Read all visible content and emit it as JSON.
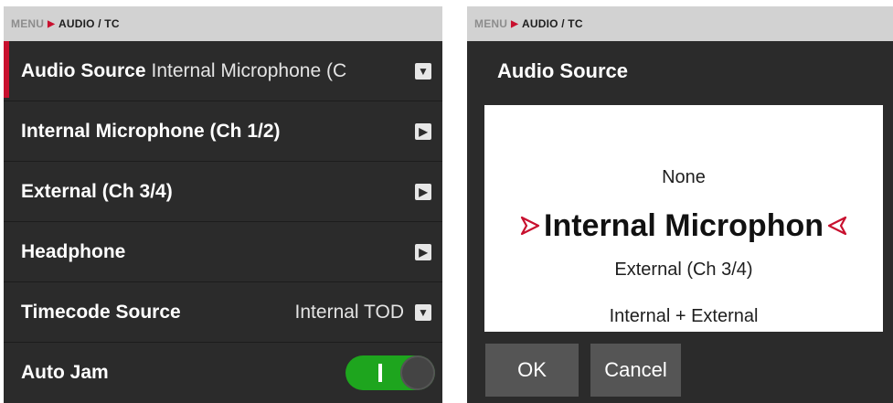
{
  "breadcrumb": {
    "root": "MENU",
    "separator": "▶",
    "current": "AUDIO / TC"
  },
  "menu": {
    "rows": [
      {
        "label": "Audio Source",
        "value": "Internal Microphone (C"
      },
      {
        "label": "Internal Microphone (Ch 1/2)"
      },
      {
        "label": "External (Ch 3/4)"
      },
      {
        "label": "Headphone"
      },
      {
        "label": "Timecode Source",
        "value": "Internal TOD"
      },
      {
        "label": "Auto Jam",
        "toggle_on": true
      }
    ]
  },
  "dialog": {
    "title": "Audio Source",
    "options": [
      "None",
      "Internal Microphon",
      "External (Ch 3/4)",
      "Internal + External"
    ],
    "selected_index": 1,
    "ok_label": "OK",
    "cancel_label": "Cancel"
  },
  "colors": {
    "accent_red": "#c8102e",
    "toggle_green": "#1ea51e",
    "panel_bg": "#2b2b2b",
    "breadcrumb_bg": "#d2d2d2"
  },
  "icons": {
    "dropdown": "chevron-down-icon",
    "submenu": "chevron-right-icon",
    "picker_left": "triangle-right-outline-icon",
    "picker_right": "triangle-left-outline-icon"
  }
}
